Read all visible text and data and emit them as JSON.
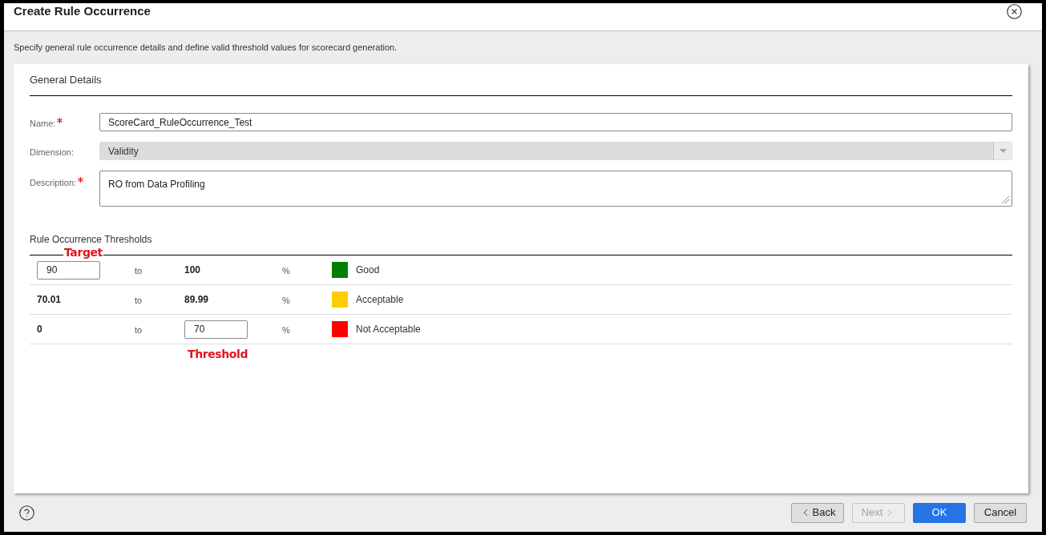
{
  "dialog": {
    "title": "Create Rule Occurrence",
    "instructions": "Specify general rule occurrence details and define valid threshold values for scorecard generation."
  },
  "general_details": {
    "heading": "General Details",
    "fields": [
      {
        "label": "Name:",
        "required": true,
        "kind": "text",
        "value": "ScoreCard_RuleOccurrence_Test",
        "disabled": false
      },
      {
        "label": "Dimension:",
        "required": false,
        "kind": "select",
        "value": "Validity",
        "disabled": true
      },
      {
        "label": "Description:",
        "required": true,
        "kind": "textarea",
        "value": "RO from Data Profiling",
        "disabled": false
      }
    ]
  },
  "thresholds": {
    "heading": "Rule Occurrence Thresholds",
    "rows": [
      {
        "from": {
          "kind": "input",
          "value": "90",
          "annotation": "Target"
        },
        "separator": "to",
        "to": {
          "kind": "text",
          "value": "100"
        },
        "unit": "%",
        "color": "#008000",
        "status": "Good"
      },
      {
        "from": {
          "kind": "text",
          "value": "70.01"
        },
        "separator": "to",
        "to": {
          "kind": "text",
          "value": "89.99"
        },
        "unit": "%",
        "color": "#ffcc00",
        "status": "Acceptable"
      },
      {
        "from": {
          "kind": "text",
          "value": "0"
        },
        "separator": "to",
        "to": {
          "kind": "input",
          "value": "70",
          "annotation": "Threshold"
        },
        "unit": "%",
        "color": "#ff0000",
        "status": "Not Acceptable"
      }
    ]
  },
  "footer": {
    "buttons": [
      {
        "label": "Back",
        "kind": "back",
        "disabled": false
      },
      {
        "label": "Next",
        "kind": "next",
        "disabled": true
      },
      {
        "label": "OK",
        "kind": "primary",
        "disabled": false
      },
      {
        "label": "Cancel",
        "kind": "secondary",
        "disabled": false
      }
    ]
  }
}
